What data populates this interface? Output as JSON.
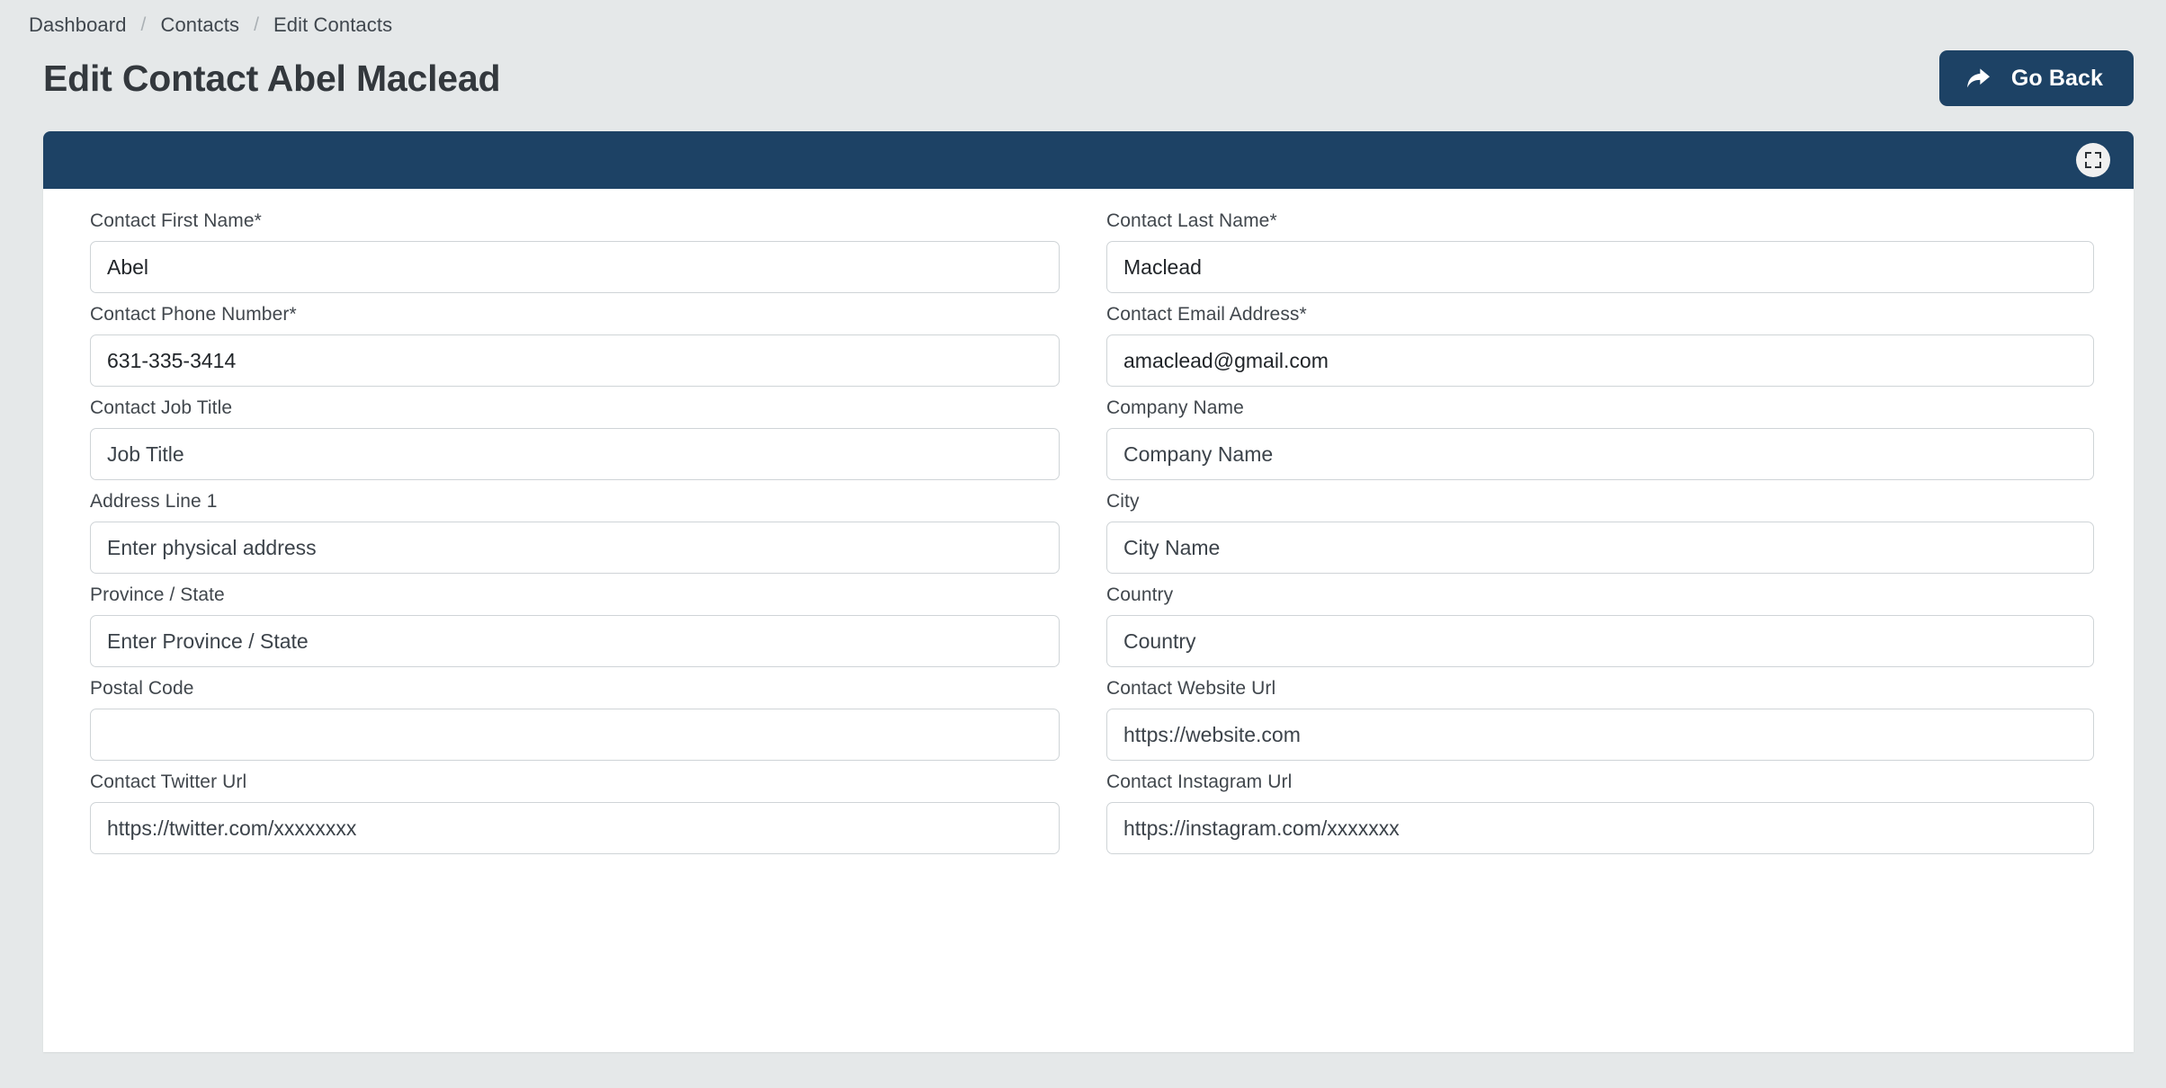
{
  "breadcrumb": {
    "items": [
      "Dashboard",
      "Contacts",
      "Edit Contacts"
    ],
    "separator": "/"
  },
  "header": {
    "title": "Edit Contact Abel Maclead",
    "go_back_label": "Go Back",
    "go_back_icon": "share-forward-arrow-icon",
    "accent_color": "#1d4265",
    "page_background": "#e5e8e9"
  },
  "card": {
    "header_color": "#1d4265",
    "expand_icon": "expand-fullscreen-icon"
  },
  "form": {
    "rows": [
      {
        "left": {
          "label": "Contact First Name*",
          "value": "Abel",
          "placeholder": ""
        },
        "right": {
          "label": "Contact Last Name*",
          "value": "Maclead",
          "placeholder": ""
        }
      },
      {
        "left": {
          "label": "Contact Phone Number*",
          "value": "631-335-3414",
          "placeholder": ""
        },
        "right": {
          "label": "Contact Email Address*",
          "value": "amaclead@gmail.com",
          "placeholder": ""
        }
      },
      {
        "left": {
          "label": "Contact Job Title",
          "value": "",
          "placeholder": "Job Title"
        },
        "right": {
          "label": "Company Name",
          "value": "",
          "placeholder": "Company Name"
        }
      },
      {
        "left": {
          "label": "Address Line 1",
          "value": "",
          "placeholder": "Enter physical address"
        },
        "right": {
          "label": "City",
          "value": "",
          "placeholder": "City Name"
        }
      },
      {
        "left": {
          "label": "Province / State",
          "value": "",
          "placeholder": "Enter Province / State"
        },
        "right": {
          "label": "Country",
          "value": "",
          "placeholder": "Country"
        }
      },
      {
        "left": {
          "label": "Postal Code",
          "value": "",
          "placeholder": ""
        },
        "right": {
          "label": "Contact Website Url",
          "value": "",
          "placeholder": "https://website.com"
        }
      },
      {
        "left": {
          "label": "Contact Twitter Url",
          "value": "",
          "placeholder": "https://twitter.com/xxxxxxxx"
        },
        "right": {
          "label": "Contact Instagram Url",
          "value": "",
          "placeholder": "https://instagram.com/xxxxxxx"
        }
      }
    ]
  }
}
